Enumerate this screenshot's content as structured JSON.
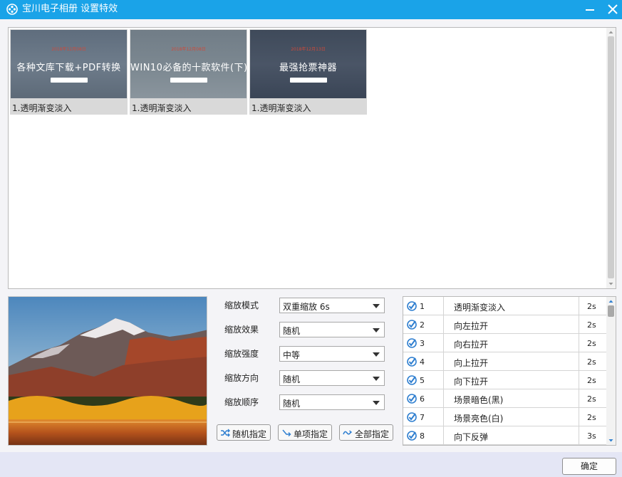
{
  "window": {
    "title": "宝川电子相册  设置特效",
    "title_bar_color": "#1aa3e8",
    "minimize_icon": "minimize-icon",
    "close_icon": "close-icon"
  },
  "photos": [
    {
      "banner_date": "2018年12月08日",
      "banner_text": "各种文库下载+PDF转换",
      "caption": "1.透明渐变淡入"
    },
    {
      "banner_date": "2018年12月08日",
      "banner_text": "WIN10必备的十款软件(下)",
      "caption": "1.透明渐变淡入"
    },
    {
      "banner_date": "2018年12月13日",
      "banner_text": "最强抢票神器",
      "caption": "1.透明渐变淡入"
    }
  ],
  "options": [
    {
      "label": "缩放模式",
      "value": "双重缩放  6s"
    },
    {
      "label": "缩放效果",
      "value": "随机"
    },
    {
      "label": "缩放强度",
      "value": "中等"
    },
    {
      "label": "缩放方向",
      "value": "随机"
    },
    {
      "label": "缩放顺序",
      "value": "随机"
    }
  ],
  "buttons": {
    "random_assign": "随机指定",
    "single_assign": "单项指定",
    "all_assign": "全部指定",
    "ok": "确定"
  },
  "effects": [
    {
      "num": "1",
      "name": "透明渐变淡入",
      "duration": "2s"
    },
    {
      "num": "2",
      "name": "向左拉开",
      "duration": "2s"
    },
    {
      "num": "3",
      "name": "向右拉开",
      "duration": "2s"
    },
    {
      "num": "4",
      "name": "向上拉开",
      "duration": "2s"
    },
    {
      "num": "5",
      "name": "向下拉开",
      "duration": "2s"
    },
    {
      "num": "6",
      "name": "场景暗色(黑)",
      "duration": "2s"
    },
    {
      "num": "7",
      "name": "场景亮色(白)",
      "duration": "2s"
    },
    {
      "num": "8",
      "name": "向下反弹",
      "duration": "3s"
    }
  ],
  "colors": {
    "accent": "#1aa3e8",
    "effect_icon": "#2f7fd0"
  }
}
